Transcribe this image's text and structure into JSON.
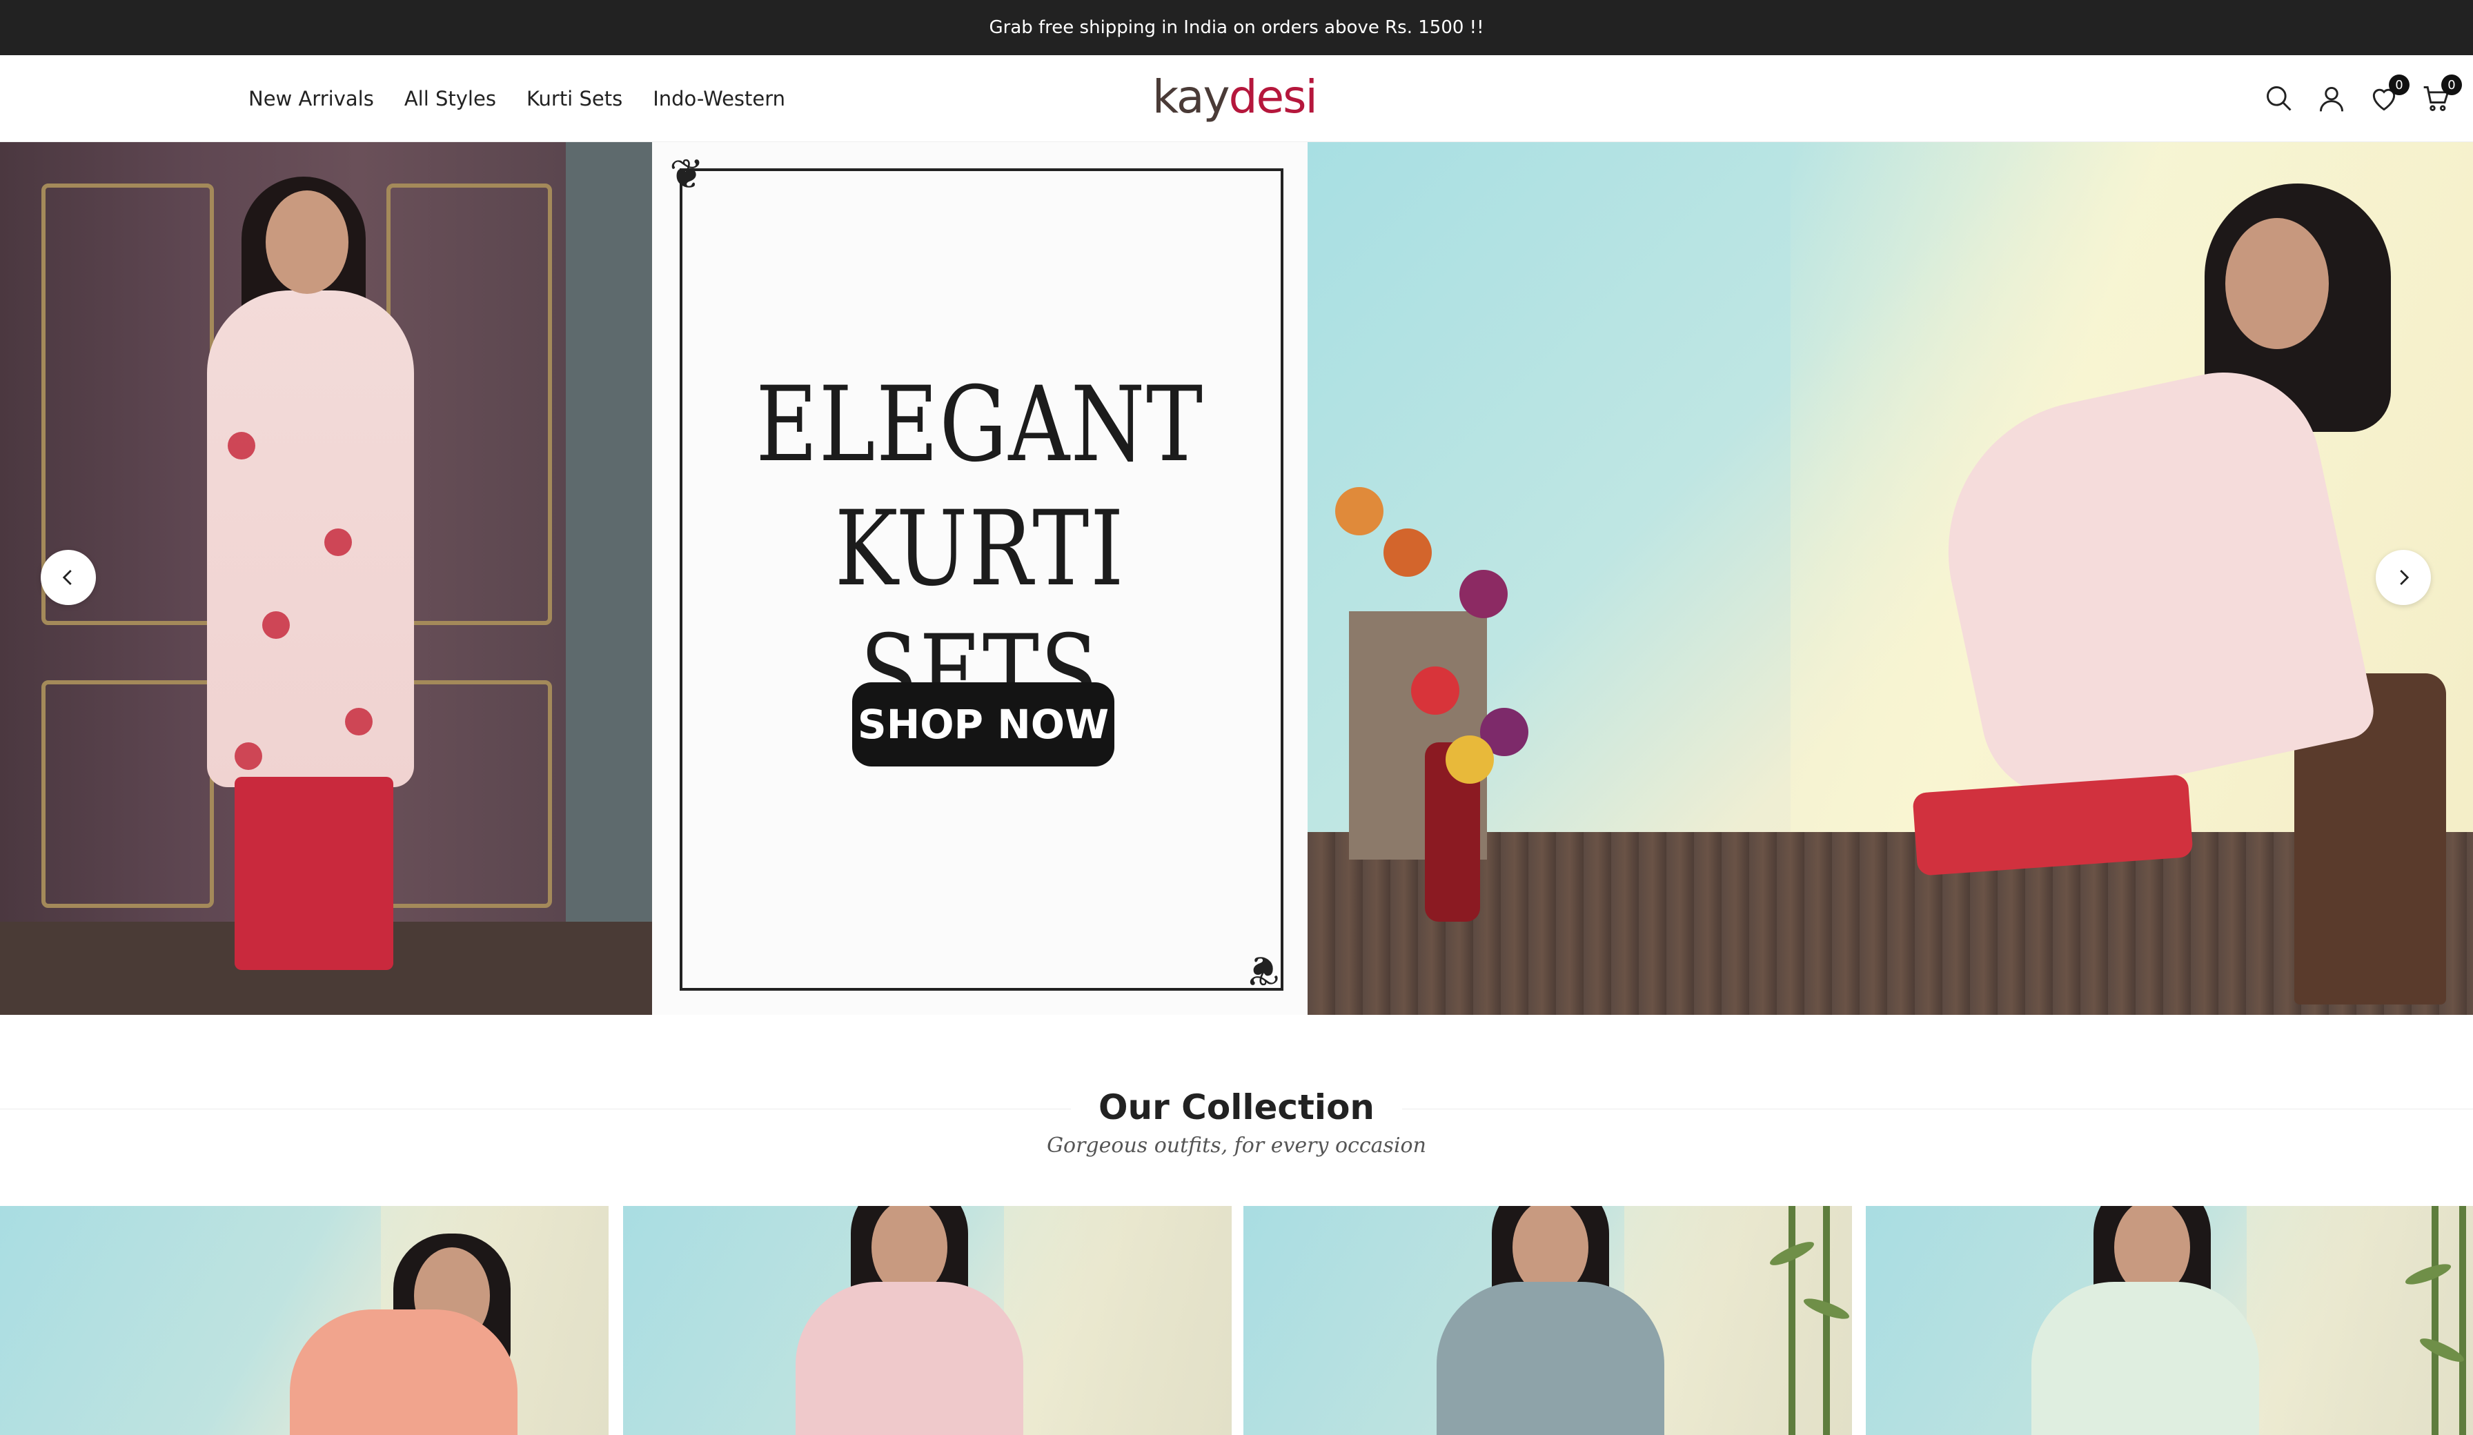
{
  "announcement": {
    "text": "Grab free shipping in India on orders above Rs. 1500 !!"
  },
  "header": {
    "nav": [
      "New Arrivals",
      "All Styles",
      "Kurti Sets",
      "Indo-Western"
    ],
    "logo": {
      "part1": "kay",
      "part2": "desi"
    },
    "wishlist_count": "0",
    "cart_count": "0",
    "icons": [
      "search-icon",
      "account-icon",
      "wishlist-heart-icon",
      "cart-icon"
    ]
  },
  "hero": {
    "title_line1": "ELEGANT",
    "title_line2": "KURTI SETS",
    "cta_label": "SHOP NOW",
    "prev_icon": "chevron-left-icon",
    "next_icon": "chevron-right-icon"
  },
  "collection": {
    "title": "Our Collection",
    "subtitle": "Gorgeous outfits, for every occasion"
  },
  "colors": {
    "announcement_bg": "#222222",
    "logo_dark": "#4a3b37",
    "logo_accent": "#b5173c",
    "cta_bg": "#141414"
  }
}
